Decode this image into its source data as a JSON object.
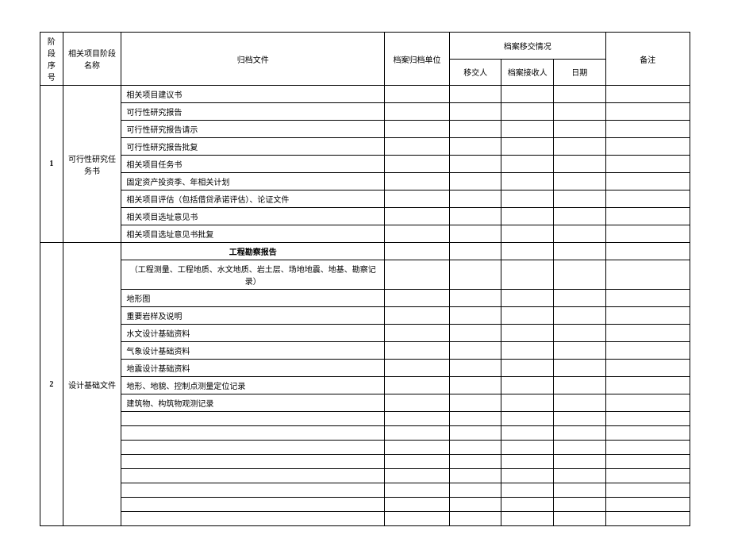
{
  "headers": {
    "seq": "阶段序号",
    "stage": "相关项目阶段名称",
    "doc": "归档文件",
    "unit": "档案归档单位",
    "transfer": "档案移交情况",
    "sender": "移交人",
    "receiver": "档案接收人",
    "date": "日期",
    "remark": "备注"
  },
  "sections": [
    {
      "seq": "1",
      "stage": "可行性研究任务书",
      "docs": [
        "相关项目建议书",
        "可行性研究报告",
        "可行性研究报告请示",
        "可行性研究报告批复",
        "相关项目任务书",
        "固定资产投资季、年相关计划",
        "相关项目评估（包括借贷承诺评估）、论证文件",
        "相关项目选址意见书",
        "相关项目选址意见书批复"
      ]
    },
    {
      "seq": "2",
      "stage": "设计基础文件",
      "docs_header": "工程勘察报告",
      "docs_subheader": "（工程测量、工程地质、水文地质、岩土层、场地地震、地基、勘察记录）",
      "docs": [
        "地形图",
        "重要岩样及说明",
        "水文设计基础资料",
        "气象设计基础资料",
        "地震设计基础资料",
        "地形、地貌、控制点测量定位记录",
        "建筑物、构筑物观测记录"
      ],
      "blank_rows": 8
    }
  ]
}
